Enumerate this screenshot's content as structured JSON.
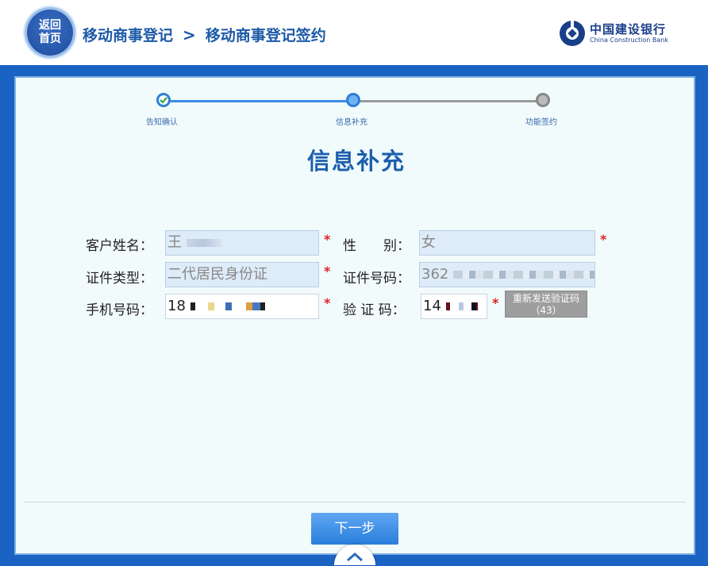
{
  "header": {
    "home_button_label": "返回首页",
    "breadcrumb": {
      "item1": "移动商事登记",
      "separator": ">",
      "item2": "移动商事登记签约"
    },
    "logo": {
      "name_cn": "中国建设银行",
      "name_en": "China Construction Bank"
    }
  },
  "steps": [
    {
      "label": "告知确认",
      "state": "done"
    },
    {
      "label": "信息补充",
      "state": "current"
    },
    {
      "label": "功能签约",
      "state": "pending"
    }
  ],
  "page_title": "信息补充",
  "form": {
    "name_label": "客户姓名：",
    "name_value": "王",
    "gender_label": "性　　别：",
    "gender_value": "女",
    "id_type_label": "证件类型：",
    "id_type_value": "二代居民身份证",
    "id_number_label": "证件号码：",
    "id_number_value": "362",
    "phone_label": "手机号码：",
    "phone_value": "18",
    "code_label": "验 证 码：",
    "code_value": "14",
    "required_mark": "*",
    "resend_label": "重新发送验证码（43）"
  },
  "footer": {
    "next_label": "下一步"
  },
  "colors": {
    "brand_blue": "#1b63c2",
    "title_blue": "#1c5fae",
    "required_red": "#e02020"
  }
}
